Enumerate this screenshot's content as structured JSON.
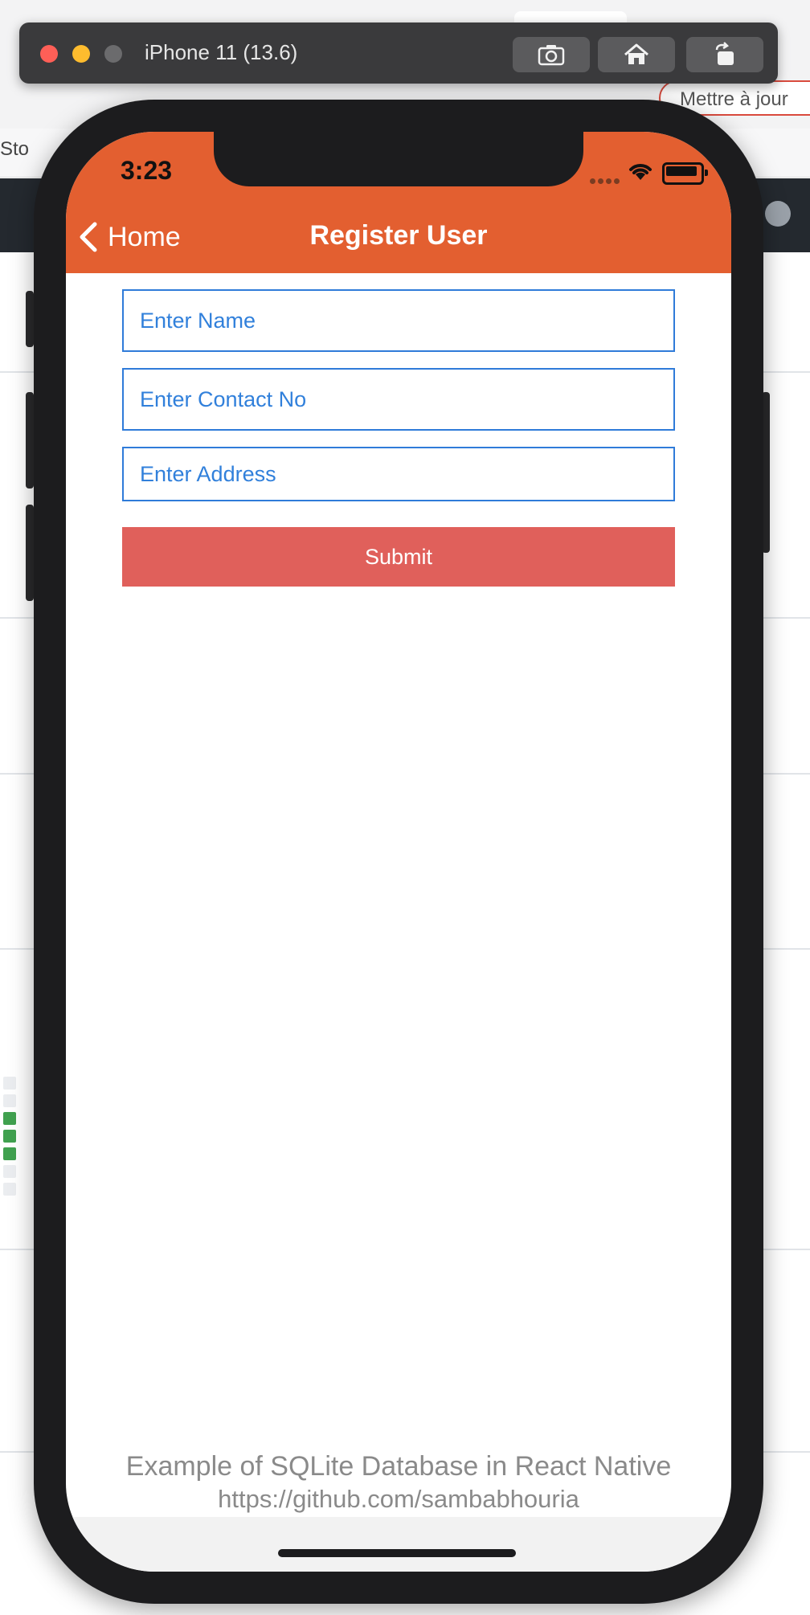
{
  "simulator": {
    "title": "iPhone 11 (13.6)",
    "buttons": [
      "screenshot-icon",
      "home-icon",
      "rotate-icon"
    ]
  },
  "background": {
    "update_label": "Mettre à jour",
    "bookmark_fragment": "Sto"
  },
  "status_bar": {
    "time": "3:23"
  },
  "nav": {
    "back_label": "Home",
    "title": "Register User",
    "color": "#e35f30"
  },
  "form": {
    "name_placeholder": "Enter Name",
    "contact_placeholder": "Enter Contact No",
    "address_placeholder": "Enter Address",
    "submit_label": "Submit",
    "submit_color": "#e0605b",
    "input_border_color": "#2f7bd9"
  },
  "footer": {
    "line1": "Example of SQLite Database in React Native",
    "line2": "https://github.com/sambabhouria"
  }
}
